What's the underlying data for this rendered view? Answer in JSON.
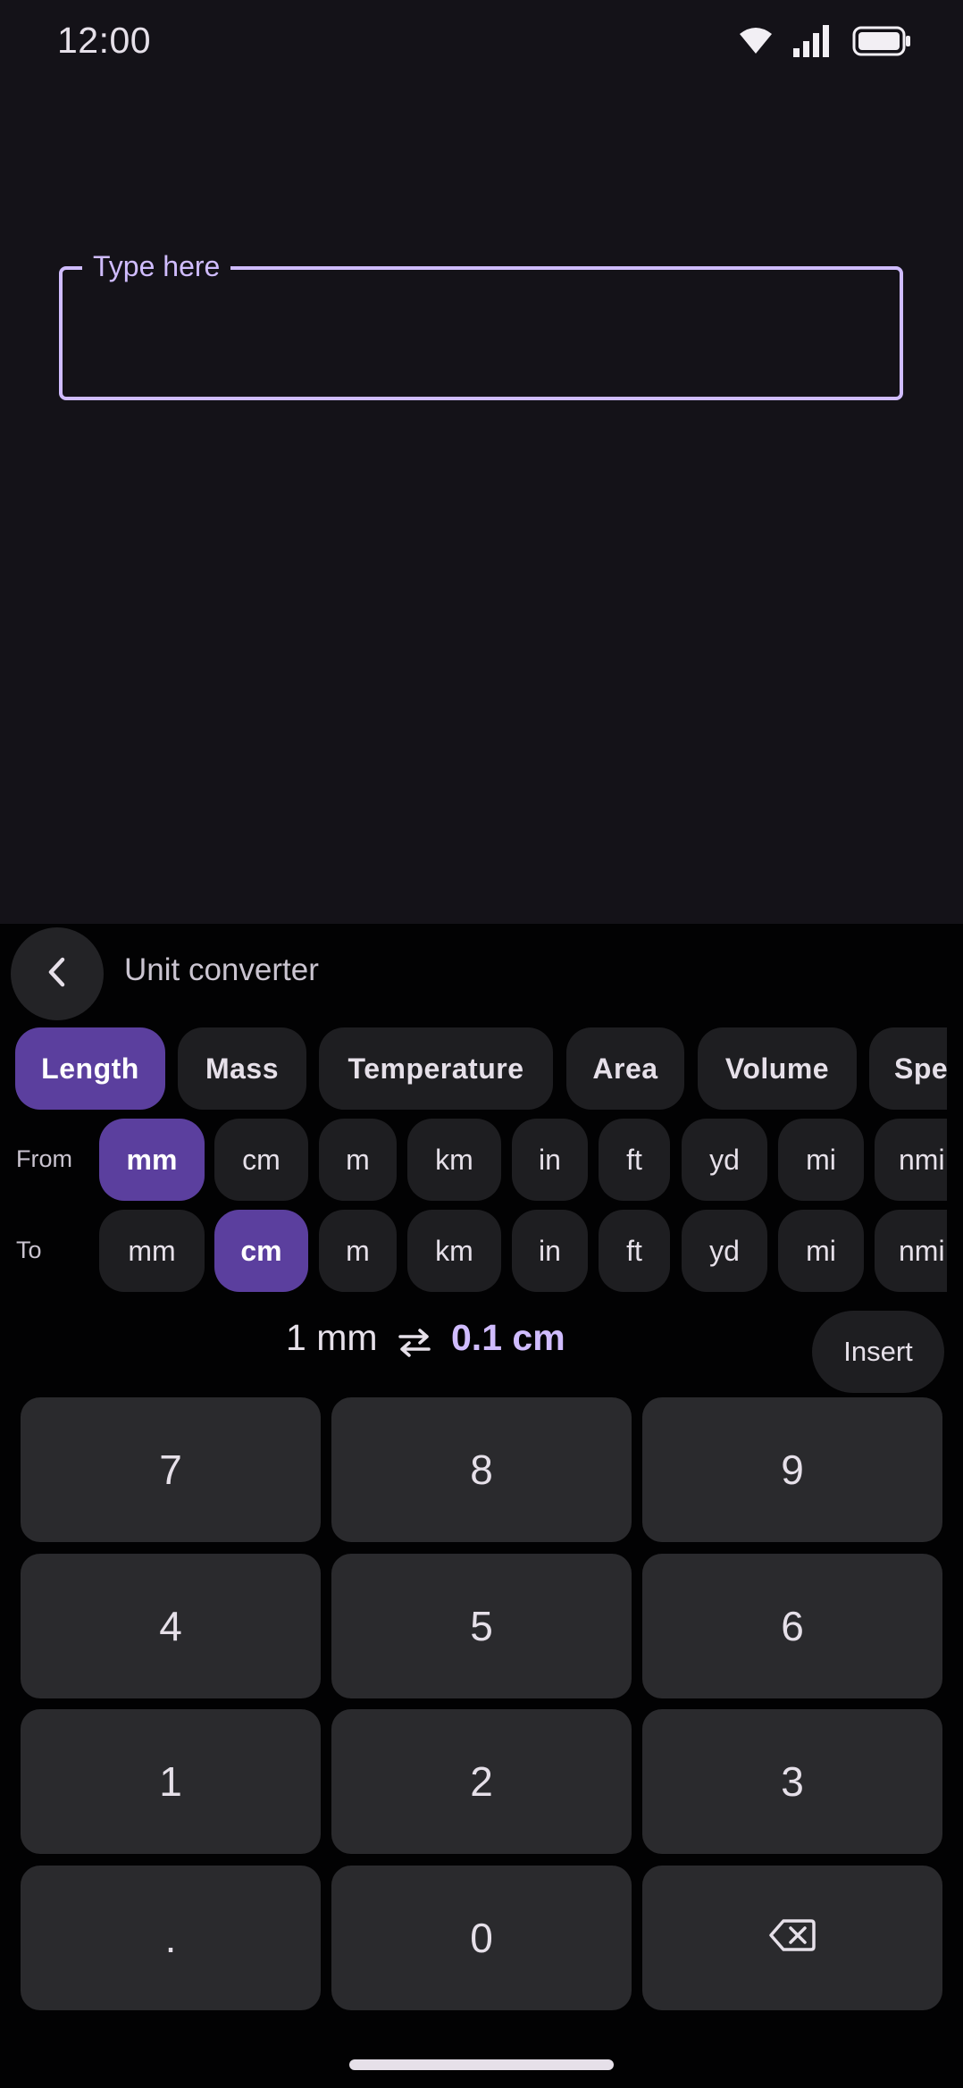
{
  "status_bar": {
    "time": "12:00",
    "icons": [
      "wifi-icon",
      "signal-icon",
      "battery-icon"
    ]
  },
  "text_field": {
    "label": "Type here",
    "value": ""
  },
  "panel": {
    "title": "Unit converter",
    "back_icon": "chevron-left-icon",
    "categories": [
      {
        "label": "Length",
        "selected": true
      },
      {
        "label": "Mass",
        "selected": false
      },
      {
        "label": "Temperature",
        "selected": false
      },
      {
        "label": "Area",
        "selected": false
      },
      {
        "label": "Volume",
        "selected": false
      },
      {
        "label": "Spe",
        "selected": false
      }
    ],
    "from": {
      "label": "From",
      "units": [
        "mm",
        "cm",
        "m",
        "km",
        "in",
        "ft",
        "yd",
        "mi",
        "nmi"
      ],
      "selected": "mm"
    },
    "to": {
      "label": "To",
      "units": [
        "mm",
        "cm",
        "m",
        "km",
        "in",
        "ft",
        "yd",
        "mi",
        "nmi"
      ],
      "selected": "cm"
    },
    "result": {
      "from_text": "1 mm",
      "to_text": "0.1 cm",
      "swap_icon": "swap-horizontal-icon"
    },
    "insert_label": "Insert",
    "keys": [
      "7",
      "8",
      "9",
      "4",
      "5",
      "6",
      "1",
      "2",
      "3",
      ".",
      "0",
      "⌫"
    ]
  },
  "colors": {
    "background": "#141218",
    "panel": "#020203",
    "accent": "#D0BCFF",
    "selected_chip": "#5B3F9E",
    "chip": "#1E1E21",
    "key": "#2A2A2D"
  }
}
